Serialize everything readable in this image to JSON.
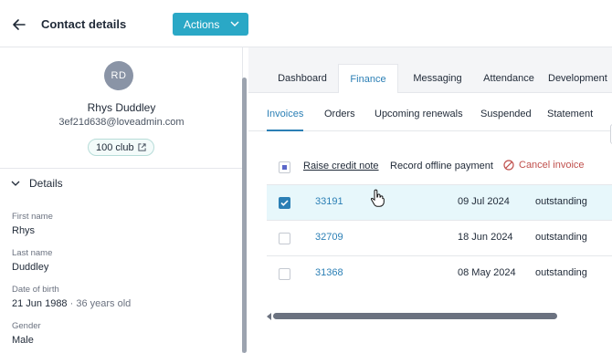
{
  "header": {
    "title": "Contact details",
    "actions_label": "Actions"
  },
  "profile": {
    "initials": "RD",
    "name": "Rhys Duddley",
    "email": "3ef21d638@loveadmin.com",
    "club_badge": "100 club",
    "details_heading": "Details",
    "fields": [
      {
        "label": "First name",
        "value": "Rhys"
      },
      {
        "label": "Last name",
        "value": "Duddley"
      },
      {
        "label": "Date of birth",
        "value": "21 Jun 1988",
        "extra": "· 36 years old"
      },
      {
        "label": "Gender",
        "value": "Male"
      }
    ]
  },
  "tabs": [
    "Dashboard",
    "Finance",
    "Messaging",
    "Attendance",
    "Development"
  ],
  "active_tab": "Finance",
  "subtabs": [
    "Invoices",
    "Orders",
    "Upcoming renewals",
    "Suspended",
    "Statement"
  ],
  "active_subtab": "Invoices",
  "bulk_actions": {
    "raise_credit_note": "Raise credit note",
    "record_offline_payment": "Record offline payment",
    "cancel_invoice": "Cancel invoice"
  },
  "invoices": [
    {
      "number": "33191",
      "date": "09 Jul 2024",
      "status": "outstanding",
      "selected": true
    },
    {
      "number": "32709",
      "date": "18 Jun 2024",
      "status": "outstanding",
      "selected": false
    },
    {
      "number": "31368",
      "date": "08 May 2024",
      "status": "outstanding",
      "selected": false
    }
  ],
  "colors": {
    "accent": "#2aa8c6",
    "link": "#2b7fb5",
    "cancel": "#c0504d",
    "selected_row": "#e7f7fb"
  }
}
